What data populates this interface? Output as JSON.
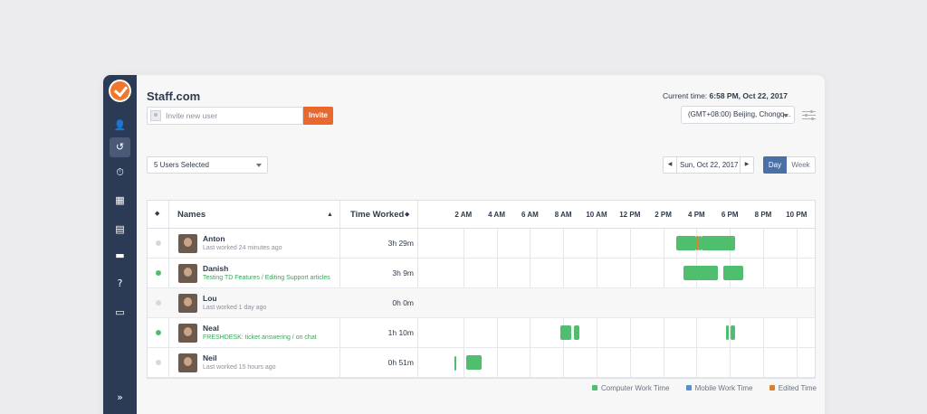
{
  "sidebar": {
    "items": [
      {
        "name": "add-user-icon",
        "glyph": "👤"
      },
      {
        "name": "history-icon",
        "glyph": "↺"
      },
      {
        "name": "timesheet-icon",
        "glyph": "⏱"
      },
      {
        "name": "calendar-icon",
        "glyph": "▦"
      },
      {
        "name": "reports-icon",
        "glyph": "▤"
      },
      {
        "name": "billing-icon",
        "glyph": "▬"
      },
      {
        "name": "help-icon",
        "glyph": "?"
      },
      {
        "name": "chat-icon",
        "glyph": "▭"
      },
      {
        "name": "expand-icon",
        "glyph": "»"
      }
    ]
  },
  "header": {
    "brand": "Staff.com",
    "current_time_label": "Current time:",
    "current_time_value": "6:58 PM, Oct 22, 2017",
    "invite_placeholder": "Invite new user",
    "invite_button": "Invite",
    "timezone": "(GMT+08:00) Beijing, Chongq..."
  },
  "controls": {
    "users_selected": "5 Users Selected",
    "date": "Sun, Oct 22, 2017",
    "prev": "◀",
    "next": "▶",
    "view_day": "Day",
    "view_week": "Week"
  },
  "table": {
    "col_sort_icon": "◆",
    "col_names": "Names",
    "col_names_sort": "▲",
    "col_time_worked": "Time Worked",
    "col_time_sort": "◆",
    "hours": [
      "2 AM",
      "4 AM",
      "6 AM",
      "8 AM",
      "10 AM",
      "12 PM",
      "2 PM",
      "4 PM",
      "6 PM",
      "8 PM",
      "10 PM"
    ],
    "rows": [
      {
        "name": "Anton",
        "status": "Last worked 24 minutes ago",
        "online": false,
        "worked": "3h 29m",
        "segments": [
          [
            14.8,
            16.0,
            "computer"
          ],
          [
            16.0,
            16.15,
            "edited"
          ],
          [
            16.15,
            16.3,
            "computer"
          ],
          [
            16.3,
            18.3,
            "computer"
          ]
        ]
      },
      {
        "name": "Danish",
        "status": "Testing TD Features / Editing Support articles",
        "online": true,
        "worked": "3h 9m",
        "segments": [
          [
            15.2,
            17.3,
            "computer"
          ],
          [
            17.6,
            18.8,
            "computer"
          ]
        ]
      },
      {
        "name": "Lou",
        "status": "Last worked 1 day ago",
        "online": false,
        "worked": "0h 0m",
        "segments": []
      },
      {
        "name": "Neal",
        "status": "FRESHDESK: ticket answering / on chat",
        "online": true,
        "worked": "1h 10m",
        "segments": [
          [
            7.8,
            8.5,
            "computer"
          ],
          [
            8.65,
            8.95,
            "computer"
          ],
          [
            17.75,
            17.95,
            "computer"
          ],
          [
            18.05,
            18.3,
            "computer"
          ]
        ]
      },
      {
        "name": "Neil",
        "status": "Last worked 15 hours ago",
        "online": false,
        "worked": "0h 51m",
        "segments": [
          [
            1.45,
            1.55,
            "computer"
          ],
          [
            2.2,
            3.1,
            "computer"
          ]
        ]
      }
    ]
  },
  "legend": {
    "computer": "Computer Work Time",
    "mobile": "Mobile Work Time",
    "edited": "Edited Time"
  },
  "colors": {
    "computer": "#4fbe6f",
    "mobile": "#5b8fd1",
    "edited": "#d9832a"
  }
}
